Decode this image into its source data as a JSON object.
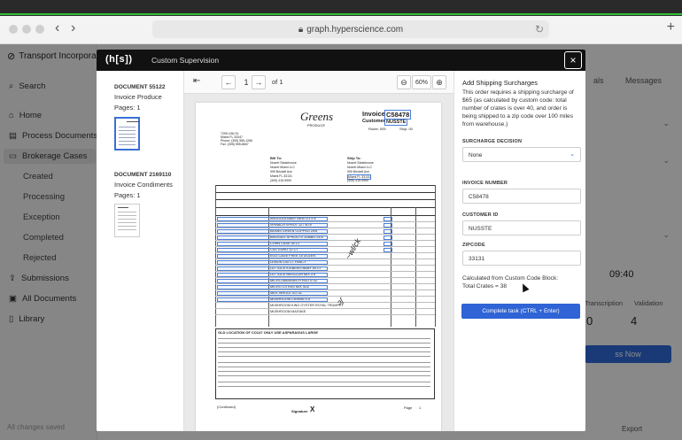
{
  "browser": {
    "url": "graph.hyperscience.com",
    "lock_icon": "lock-icon",
    "new_tab": "+"
  },
  "app": {
    "brand": "Transport Incorpora",
    "nav": [
      {
        "label": "Search",
        "icon": "search-icon"
      },
      {
        "label": "Home",
        "icon": "home-icon"
      },
      {
        "label": "Process Documents",
        "icon": "document-icon"
      },
      {
        "label": "Brokerage Cases",
        "icon": "folder-icon"
      },
      {
        "label": "Created"
      },
      {
        "label": "Processing"
      },
      {
        "label": "Exception"
      },
      {
        "label": "Completed"
      },
      {
        "label": "Rejected"
      },
      {
        "label": "Submissions",
        "icon": "submissions-icon"
      },
      {
        "label": "All Documents",
        "icon": "documents-icon"
      },
      {
        "label": "Library",
        "icon": "library-icon"
      }
    ],
    "saved_status": "All changes saved",
    "right": {
      "tab_als": "als",
      "tab_messages": "Messages",
      "time": "09:40",
      "col_transcription": "Transcription",
      "col_validation": "Validation",
      "val_transcription": "0",
      "val_validation": "4",
      "primary_button": "ss Now",
      "export_label": "Export"
    }
  },
  "modal": {
    "logo": "(h[s])",
    "title": "Custom Supervision",
    "close_label": "×",
    "documents": [
      {
        "number": "DOCUMENT 55122",
        "title": "Invoice Produce",
        "pages": "Pages: 1"
      },
      {
        "number": "DOCUMENT 2169110",
        "title": "Invoice Condiments",
        "pages": "Pages: 1"
      }
    ],
    "viewer": {
      "page_value": "1",
      "of_pages": "of 1",
      "zoom": "60%"
    },
    "invoice": {
      "brand": "Greens",
      "brand_sub": "PRODUCE",
      "invoice_label": "Invoice",
      "invoice_number": "C58478",
      "customer_label": "Customer",
      "customer_id": "NUSSTE",
      "route": "Route: 005",
      "stop": "Stop: 00",
      "from_lines": [
        "7295 10th St.",
        "Miami FL 33347",
        "Phone: (305) 555-1266",
        "Fax: (305) 555-8667"
      ],
      "bill_to_label": "Bill To:",
      "bill_to": [
        "Nusret Steakhouse",
        "Nusret Miami LLC",
        "999 Brickell Ave",
        "Miami FL 33131",
        "(305) 415-9990"
      ],
      "ship_to_label": "Ship To:",
      "ship_to": [
        "Nusret Steakhouse",
        "Nusret Miami LLC",
        "999 Brickell Ave",
        "Miami FL 33131",
        "(305) 415-9990"
      ],
      "items": [
        "ARUGULA BABY BKW 2/1.5 #",
        "SPINACH SPROT 12 / 40 #",
        "BEANS GREEN CLIPPED 20/6",
        "BRUSSEL SPROUTS JUMBO 25 #",
        "CORN CASE 40 CT",
        "CUC EURO 12 CT",
        "EGG CAGE FREE 15 DOZEN",
        "LEMON 140 CT FANCY",
        "LETTUCE ICEBERG BABY 40 CT",
        "LETTUCE MESCLUN MIX 3 #",
        "MICRO AMARANTH RED 4 OZ",
        "MICRO CITRUS MIX 4OZ",
        "MILK WHOLE 4/1 GL",
        "MUSHROOM CRIMINI 5 #",
        "MUSHROOM KING OYSTER ROYAL TRUMPET",
        "MUSHROOM MAITAKE"
      ],
      "old_location_note": "OLD LOCATION OF CO147 ONLY USE ASPARAGUS LARGE",
      "continued": "(Continued)",
      "signature_label": "Signature",
      "signature_mark": "X",
      "page_label": "Page",
      "page_num": "1"
    },
    "panel": {
      "title": "Add Shipping Surcharges",
      "description": "This order requires a shipping surcharge of $65 (as calculated by custom code: total number of crates is over 40, and order is being shipped to a zip code over 100 miles from warehouse.)",
      "surcharge_label": "SURCHARGE DECISION",
      "surcharge_value": "None",
      "invoice_number_label": "INVOICE NUMBER",
      "invoice_number_value": "C58478",
      "customer_id_label": "CUSTOMER ID",
      "customer_id_value": "NUSSTE",
      "zipcode_label": "ZIPCODE",
      "zipcode_value": "33131",
      "calc_line1": "Calculated from Custom Code Block:",
      "calc_line2": "Total Crates = 38",
      "complete_button": "Complete task (CTRL + Enter)"
    }
  }
}
